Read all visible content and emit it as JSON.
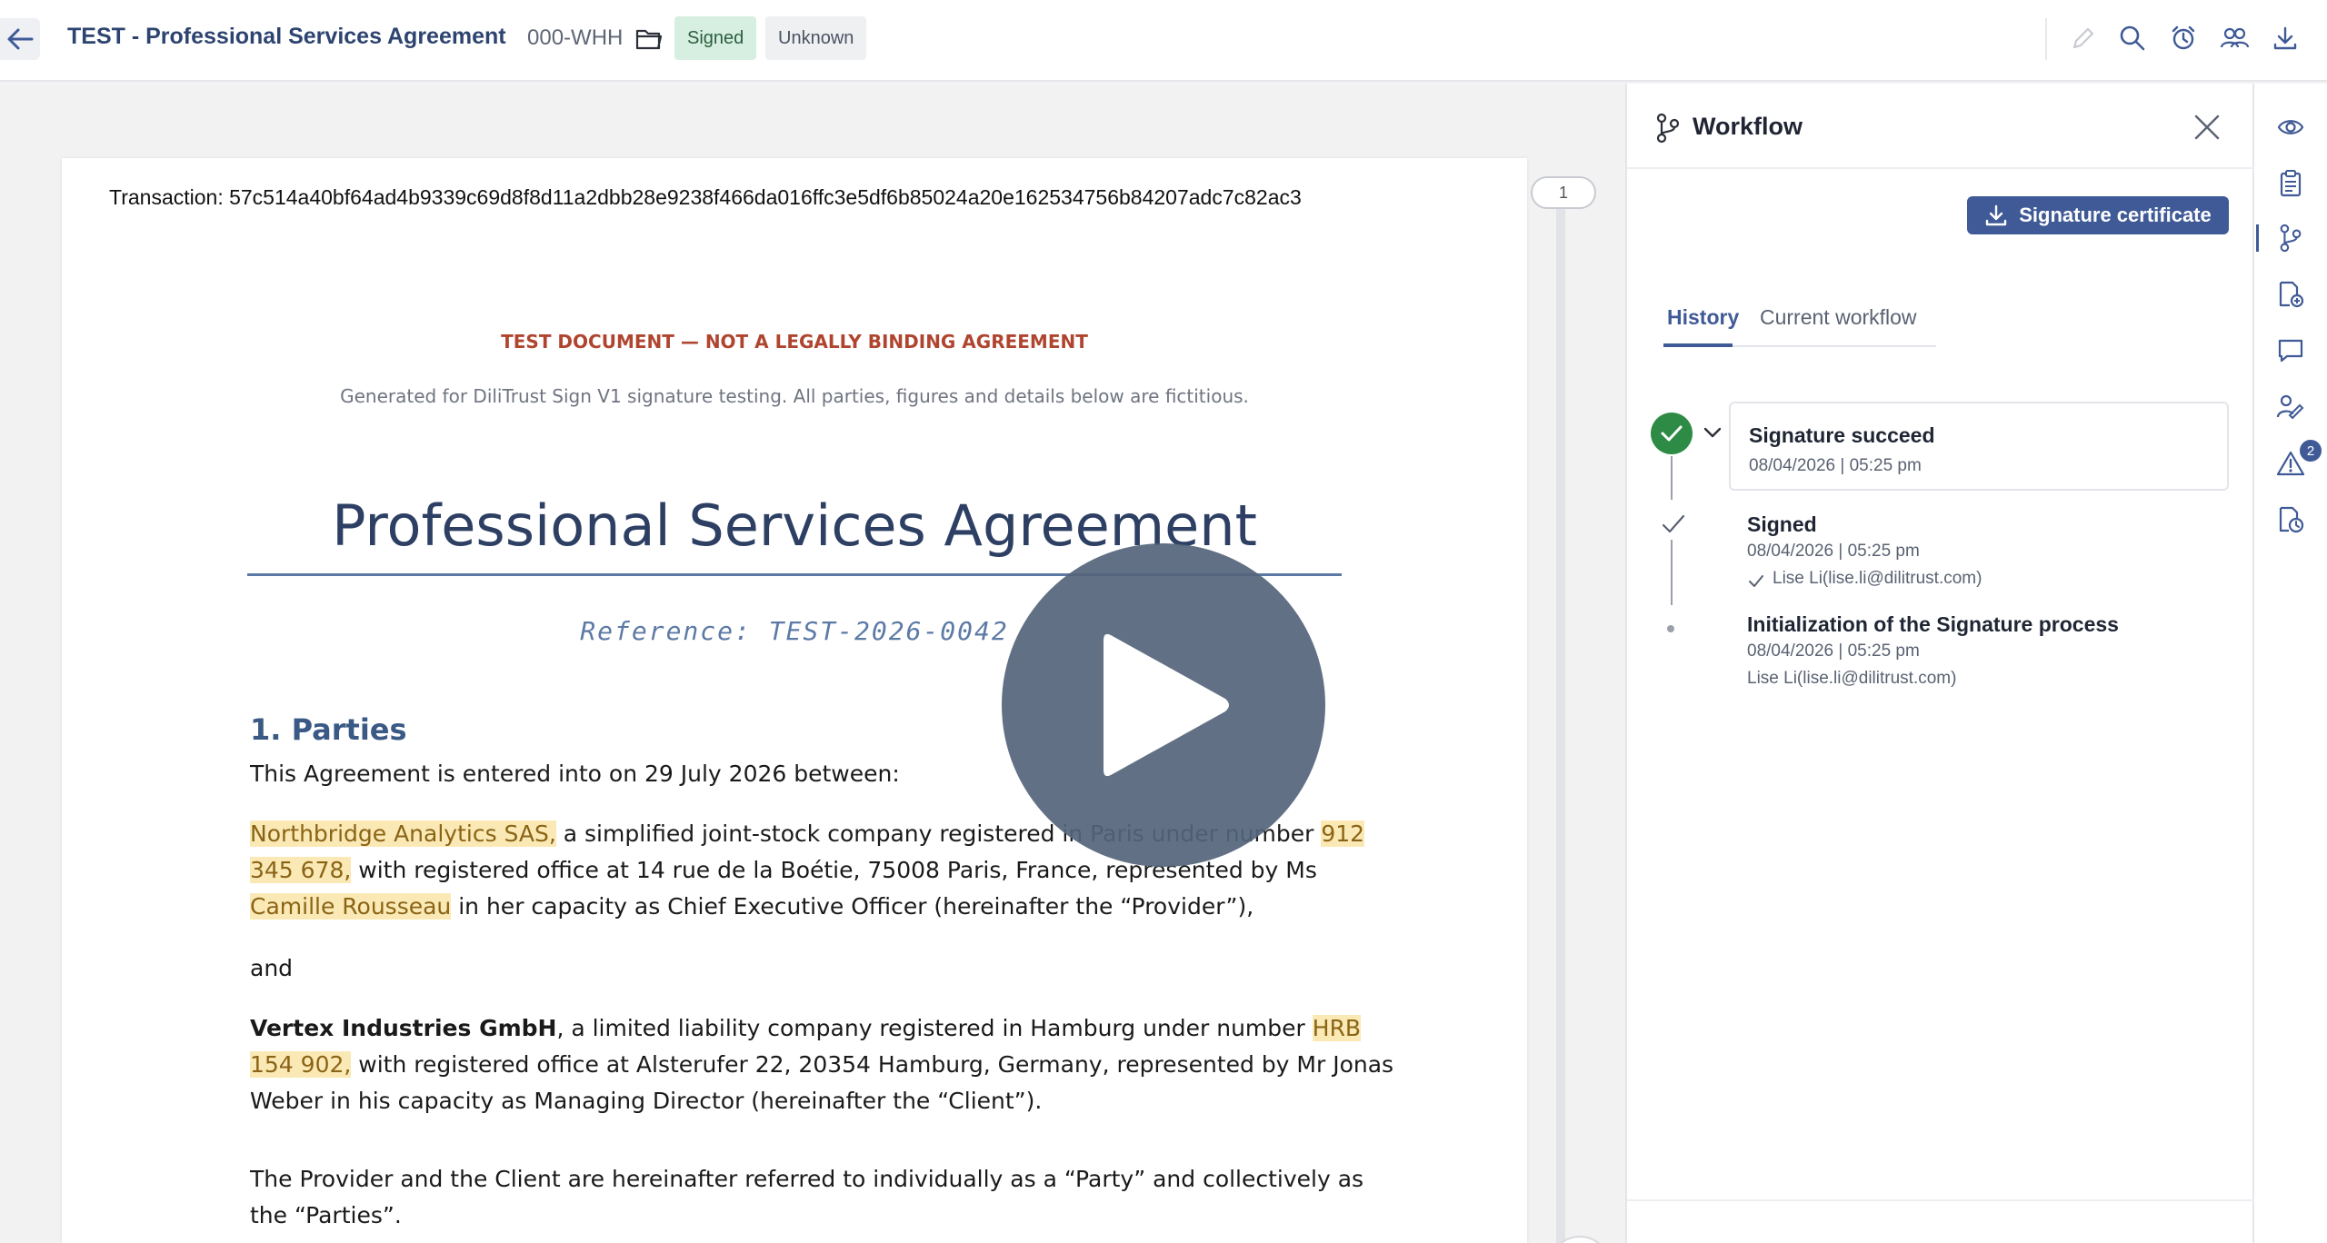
{
  "header": {
    "title": "TEST - Professional Services Agreement",
    "doc_id": "000-WHH",
    "status_badge": "Signed",
    "type_badge": "Unknown"
  },
  "document": {
    "transaction": "Transaction: 57c514a40bf64ad4b9339c69d8f8d11a2dbb28e9238f466da016ffc3e5df6b85024a20e162534756b84207adc7c82ac3",
    "warning": "TEST DOCUMENT — NOT A LEGALLY BINDING AGREEMENT",
    "generated_note": "Generated for DiliTrust Sign V1 signature testing. All parties, figures and details below are fictitious.",
    "title": "Professional Services Agreement",
    "reference": "Reference: TEST-2026-0042",
    "section_heading": "1. Parties",
    "intro": "This Agreement is entered into on 29 July 2026 between:",
    "provider": {
      "name": "Northbridge Analytics SAS,",
      "text1": " a simplified joint-stock company registered in Paris under number ",
      "reg_number": "912 345 678,",
      "text2": " with registered office at 14 rue de la Boétie, 75008 Paris, France, represented by Ms ",
      "representative": "Camille Rousseau",
      "text3": " in her capacity as Chief Executive Officer (hereinafter the “Provider”),"
    },
    "and_word": "and",
    "client": {
      "name": "Vertex Industries GmbH",
      "text1": ", a limited liability company registered in Hamburg under number ",
      "reg_number": "HRB 154 902,",
      "text2": " with registered office at Alsterufer 22, 20354 Hamburg, Germany, represented by Mr Jonas Weber in his capacity as Managing Director (hereinafter the “Client”)."
    },
    "closing": "The Provider and the Client are hereinafter referred to individually as a “Party” and collectively as the “Parties”.",
    "page_number": "1"
  },
  "workflow_panel": {
    "title": "Workflow",
    "certificate_button": "Signature certificate",
    "tabs": [
      "History",
      "Current workflow"
    ],
    "events": [
      {
        "title": "Signature succeed",
        "date": "08/04/2026 | 05:25 pm"
      },
      {
        "title": "Signed",
        "date": "08/04/2026 | 05:25 pm",
        "user": "Lise Li(lise.li@dilitrust.com)"
      },
      {
        "title": "Initialization of the Signature process",
        "date": "08/04/2026 | 05:25 pm",
        "user": "Lise Li(lise.li@dilitrust.com)"
      }
    ]
  },
  "rail": {
    "alerts_count": "2"
  },
  "colors": {
    "brand": "#3f5a96",
    "success": "#2e8b45",
    "highlight": "#fbe9b5",
    "warning_text": "#b0452f"
  },
  "icons": {
    "header": [
      "back-arrow-icon",
      "folder-icon",
      "pencil-icon",
      "search-icon",
      "alarm-icon",
      "users-icon",
      "download-icon"
    ],
    "rail": [
      "eye-icon",
      "clipboard-icon",
      "workflow-icon",
      "document-add-icon",
      "comment-icon",
      "signer-icon",
      "warning-icon",
      "document-clock-icon"
    ]
  }
}
